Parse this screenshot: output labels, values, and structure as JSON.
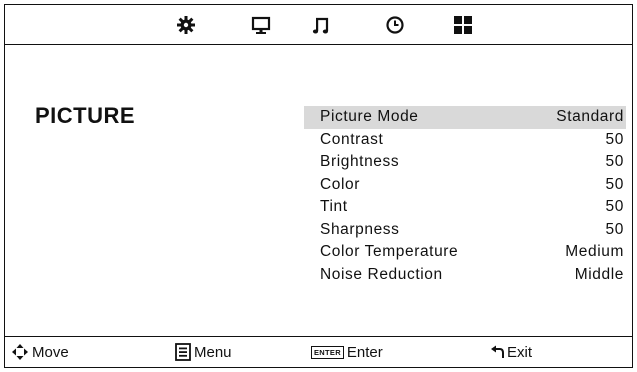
{
  "menu": {
    "tabs": [
      {
        "icon": "gear-icon"
      },
      {
        "icon": "monitor-icon"
      },
      {
        "icon": "music-note-icon"
      },
      {
        "icon": "clock-icon"
      },
      {
        "icon": "grid-icon"
      }
    ],
    "title": "PICTURE",
    "items": [
      {
        "label": "Picture Mode",
        "value": "Standard",
        "selected": true
      },
      {
        "label": "Contrast",
        "value": "50"
      },
      {
        "label": "Brightness",
        "value": "50"
      },
      {
        "label": "Color",
        "value": "50"
      },
      {
        "label": "Tint",
        "value": "50"
      },
      {
        "label": "Sharpness",
        "value": "50"
      },
      {
        "label": "Color Temperature",
        "value": "Medium"
      },
      {
        "label": "Noise Reduction",
        "value": "Middle"
      }
    ]
  },
  "footer": {
    "move": "Move",
    "menu": "Menu",
    "enter_key": "ENTER",
    "enter": "Enter",
    "exit": "Exit"
  },
  "colors": {
    "highlight": "#d9d9d9",
    "foreground": "#111111",
    "background": "#ffffff"
  }
}
